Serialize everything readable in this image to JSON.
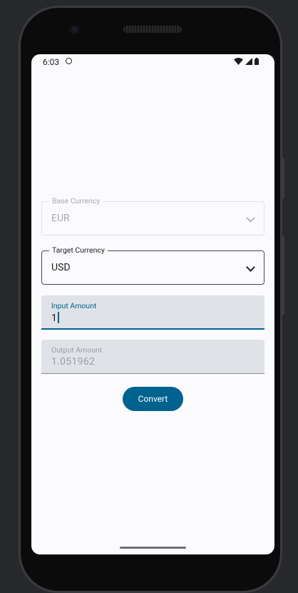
{
  "status_bar": {
    "time": "6:03",
    "icons": [
      "sync-icon",
      "wifi-icon",
      "signal-icon",
      "battery-icon"
    ]
  },
  "form": {
    "base_currency": {
      "label": "Base Currency",
      "value": "EUR",
      "disabled": true
    },
    "target_currency": {
      "label": "Target Currency",
      "value": "USD"
    },
    "input_amount": {
      "label": "Input Amount",
      "value": "1"
    },
    "output_amount": {
      "label": "Output Amount",
      "value": "1.051962"
    },
    "convert_label": "Convert"
  },
  "colors": {
    "accent": "#00628f",
    "screen_bg": "#fbfbfe",
    "filled_bg": "#dfe3e8",
    "outer_bg": "#27282b"
  }
}
